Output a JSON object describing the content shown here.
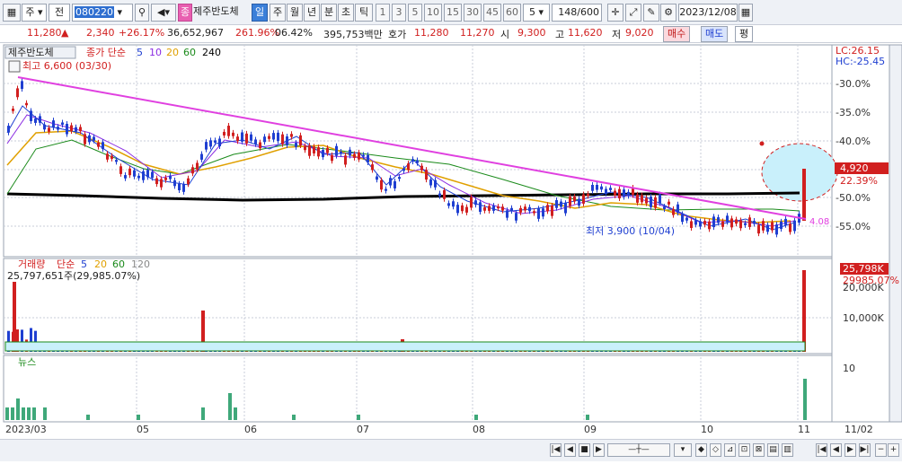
{
  "toolbar": {
    "mode": "주",
    "market": "전",
    "code": "080220",
    "stock_name": "제주반도체",
    "badge": "종",
    "periods": [
      "일",
      "주",
      "월",
      "년",
      "분",
      "초",
      "틱"
    ],
    "active_period": "일",
    "intervals": [
      "1",
      "3",
      "5",
      "10",
      "15",
      "30",
      "45",
      "60"
    ],
    "count_value": "5",
    "range": "148/600",
    "date": "2023/12/08"
  },
  "info": {
    "price": "11,280",
    "change": "2,340",
    "change_pct": "+26.17%",
    "volume": "36,652,967",
    "vol_ratio": "261.96%",
    "turnover": "06.42%",
    "amount": "395,753백만",
    "ask_label": "호가",
    "ask1": "11,280",
    "ask2": "11,270",
    "open_label": "시",
    "open": "9,300",
    "high_label": "고",
    "high": "11,620",
    "low_label": "저",
    "low": "9,020",
    "buy_label": "매수",
    "sell_label": "매도",
    "eval_label": "평"
  },
  "price_panel": {
    "title": "제주반도체",
    "ma_label": "종가 단순",
    "ma_periods": [
      "5",
      "10",
      "20",
      "60",
      "240"
    ],
    "ma_colors": [
      "#1f3fd1",
      "#8a2be2",
      "#e0a000",
      "#1a8a1a",
      "#000000"
    ],
    "max_label": "최고 6,600 (03/30)",
    "min_label": "최저 3,900 (10/04)",
    "lc": "LC:26.15",
    "hc": "HC:-25.45",
    "y_ticks": [
      "-30.0%",
      "-35.0%",
      "-40.0%",
      "-45.0%",
      "-50.0%",
      "-55.0%"
    ],
    "cur_label": "4,920",
    "cur_pct": "22.39%",
    "trend_end": "4.08"
  },
  "volume_panel": {
    "title": "거래량",
    "ma_label": "단순",
    "ma_periods": [
      "5",
      "20",
      "60",
      "120"
    ],
    "value_label": "25,797,651주(29,985.07%)",
    "y_ticks": [
      "20,000K",
      "10,000K"
    ],
    "cur_label": "25,798K",
    "cur_pct": "29985.07%"
  },
  "news_panel": {
    "title": "뉴스",
    "y_tick": "10"
  },
  "x_axis": [
    "2023/03",
    "05",
    "06",
    "07",
    "08",
    "09",
    "10",
    "11",
    "11/02"
  ],
  "chart_data": {
    "type": "candlestick",
    "y_unit": "% change",
    "ylim": [
      -58,
      -26
    ],
    "x": [
      "2023/03",
      "05",
      "06",
      "07",
      "08",
      "09",
      "10",
      "11"
    ],
    "close_approx": [
      -33,
      -40,
      -39,
      -42,
      -47,
      -54,
      -55,
      -52,
      -46
    ],
    "ma240_approx": [
      -50,
      -51,
      -51,
      -51,
      -50,
      -50,
      -50,
      -49
    ]
  }
}
